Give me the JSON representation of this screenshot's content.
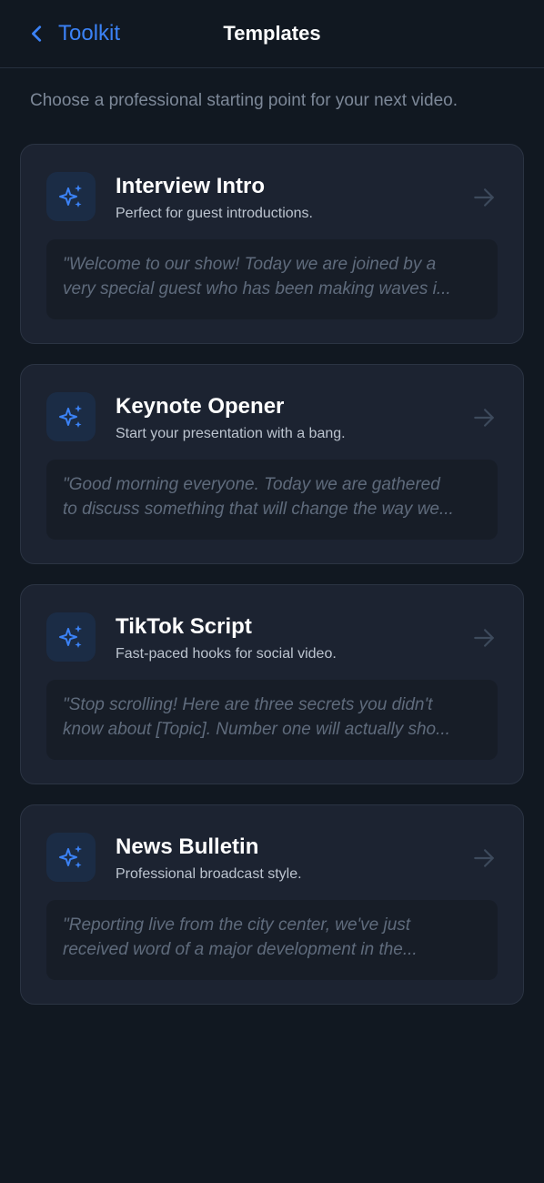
{
  "header": {
    "back_label": "Toolkit",
    "title": "Templates"
  },
  "subtitle": "Choose a professional starting point for your next video.",
  "colors": {
    "accent": "#3b82f6",
    "background": "#111821",
    "card": "#1c2331"
  },
  "templates": [
    {
      "icon": "sparkles-icon",
      "title": "Interview Intro",
      "description": "Perfect for guest introductions.",
      "preview_line1": "\"Welcome to our show! Today we are joined by a",
      "preview_line2": "very special guest who has been making waves i..."
    },
    {
      "icon": "sparkles-icon",
      "title": "Keynote Opener",
      "description": "Start your presentation with a bang.",
      "preview_line1": "\"Good morning everyone. Today we are gathered",
      "preview_line2": "to discuss something that will change the way we..."
    },
    {
      "icon": "sparkles-icon",
      "title": "TikTok Script",
      "description": "Fast-paced hooks for social video.",
      "preview_line1": "\"Stop scrolling! Here are three secrets you didn't",
      "preview_line2": "know about [Topic]. Number one will actually sho..."
    },
    {
      "icon": "sparkles-icon",
      "title": "News Bulletin",
      "description": "Professional broadcast style.",
      "preview_line1": "\"Reporting live from the city center, we've just",
      "preview_line2": "received word of a major development in the..."
    }
  ]
}
